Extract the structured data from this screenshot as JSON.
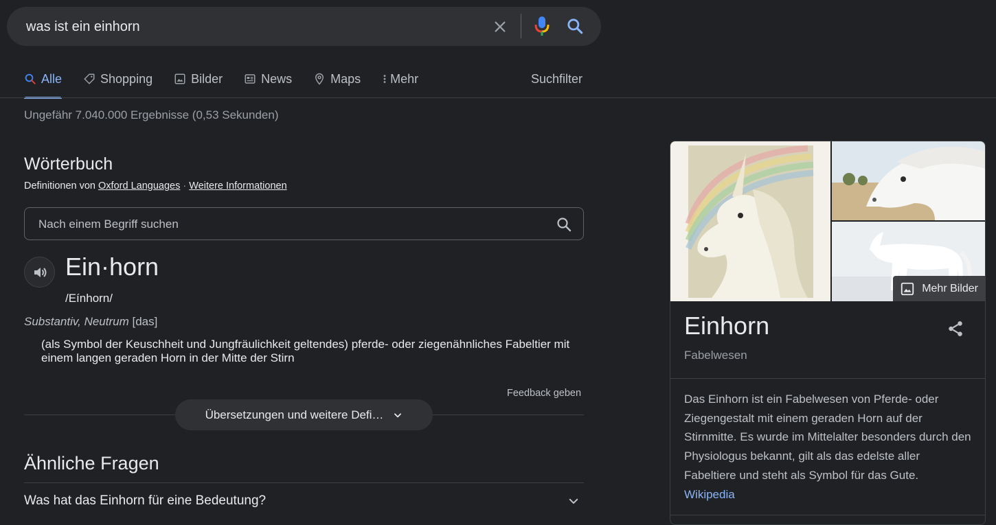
{
  "search": {
    "query": "was ist ein einhorn"
  },
  "tabs": [
    {
      "label": "Alle",
      "icon": "search-icon",
      "active": true
    },
    {
      "label": "Shopping",
      "icon": "tag-icon"
    },
    {
      "label": "Bilder",
      "icon": "image-icon"
    },
    {
      "label": "News",
      "icon": "news-icon"
    },
    {
      "label": "Maps",
      "icon": "map-pin-icon"
    },
    {
      "label": "Mehr",
      "icon": "more-vert-icon"
    }
  ],
  "suchfilter": "Suchfilter",
  "result_stats": "Ungefähr 7.040.000 Ergebnisse (0,53 Sekunden)",
  "dictionary": {
    "title": "Wörterbuch",
    "source_prefix": "Definitionen von",
    "source_link": "Oxford Languages",
    "source_sep": "·",
    "more_info": "Weitere Informationen",
    "search_placeholder": "Nach einem Begriff suchen",
    "word": "Ein·horn",
    "phonetic": "/Eínhorn/",
    "pos": "Substantiv, Neutrum",
    "gender": "[das]",
    "definition": "(als Symbol der Keuschheit und Jungfräulichkeit geltendes) pferde- oder ziegenähnliches Fabeltier mit einem langen geraden Horn in der Mitte der Stirn",
    "feedback": "Feedback geben",
    "more_button": "Übersetzungen und weitere Defi…"
  },
  "faq": {
    "title": "Ähnliche Fragen",
    "items": [
      "Was hat das Einhorn für eine Bedeutung?"
    ]
  },
  "knowledge_panel": {
    "more_images": "Mehr Bilder",
    "title": "Einhorn",
    "subtitle": "Fabelwesen",
    "description": "Das Einhorn ist ein Fabelwesen von Pferde- oder Ziegengestalt mit einem geraden Horn auf der Stirnmitte. Es wurde im Mittelalter besonders durch den Physiologus bekannt, gilt als das edelste aller Fabeltiere und steht als Symbol für das Gute.",
    "source": "Wikipedia"
  },
  "colors": {
    "background": "#202124",
    "accent": "#8ab4f8",
    "surface": "#303134"
  }
}
